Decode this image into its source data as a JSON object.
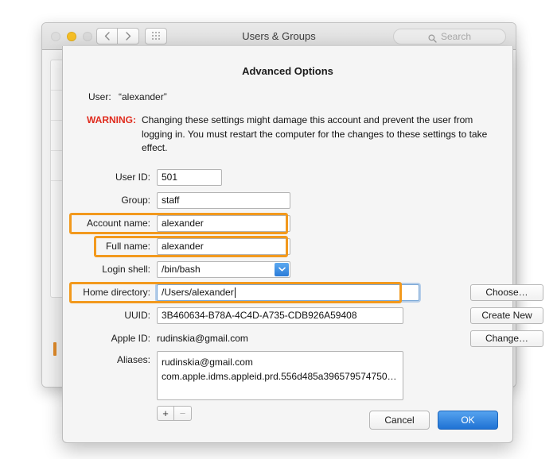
{
  "window": {
    "title": "Users & Groups",
    "traffic_lights": [
      "close-button",
      "minimize-button",
      "zoom-button"
    ],
    "nav_back_icon": "chevron-left-icon",
    "nav_forward_icon": "chevron-right-icon",
    "grid_icon": "grid-view-icon",
    "search": {
      "placeholder": "Search",
      "icon": "search-icon"
    }
  },
  "sheet": {
    "title": "Advanced Options",
    "user_label": "User:",
    "user_value": "“alexander”",
    "warning_label": "WARNING:",
    "warning_text": "Changing these settings might damage this account and prevent the user from logging in. You must restart the computer for the changes to these settings to take effect.",
    "warning_color": "#e02b1d",
    "annotation_color": "#f2991d",
    "fields": {
      "user_id": {
        "label": "User ID:",
        "value": "501"
      },
      "group": {
        "label": "Group:",
        "value": "staff"
      },
      "account_name": {
        "label": "Account name:",
        "value": "alexander",
        "highlighted": true
      },
      "full_name": {
        "label": "Full name:",
        "value": "alexander",
        "highlighted": true
      },
      "login_shell": {
        "label": "Login shell:",
        "value": "/bin/bash",
        "arrow_icon": "chevron-down-icon"
      },
      "home_directory": {
        "label": "Home directory:",
        "value": "/Users/alexander",
        "highlighted": true,
        "focused": true
      },
      "uuid": {
        "label": "UUID:",
        "value": "3B460634-B78A-4C4D-A735-CDB926A59408"
      },
      "apple_id": {
        "label": "Apple ID:",
        "value": "rudinskia@gmail.com"
      },
      "aliases": {
        "label": "Aliases:",
        "items": [
          "rudinskia@gmail.com",
          "com.apple.idms.appleid.prd.556d485a396579574750…"
        ]
      }
    },
    "side_buttons": {
      "choose": "Choose…",
      "create_new": "Create New",
      "change": "Change…"
    },
    "list_controls": {
      "add": "+",
      "remove": "−"
    },
    "footer": {
      "cancel": "Cancel",
      "ok": "OK"
    }
  }
}
